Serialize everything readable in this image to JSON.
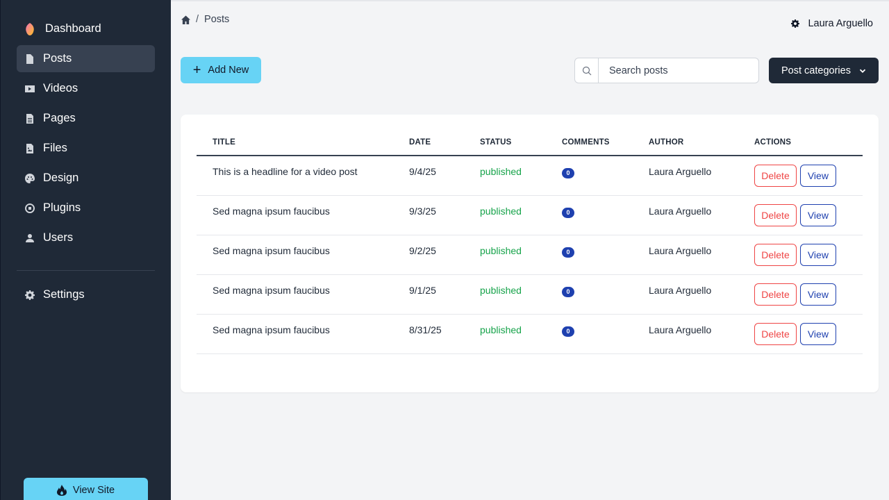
{
  "sidebar": {
    "brand": {
      "label": "Dashboard",
      "icon": "leaf-logo-icon",
      "colors": [
        "#f472b6",
        "#fbbf24"
      ]
    },
    "items": [
      {
        "label": "Posts",
        "icon": "file-icon",
        "active": true
      },
      {
        "label": "Videos",
        "icon": "video-icon",
        "active": false
      },
      {
        "label": "Pages",
        "icon": "document-icon",
        "active": false
      },
      {
        "label": "Files",
        "icon": "file-image-icon",
        "active": false
      },
      {
        "label": "Design",
        "icon": "palette-icon",
        "active": false
      },
      {
        "label": "Plugins",
        "icon": "plugin-icon",
        "active": false
      },
      {
        "label": "Users",
        "icon": "user-icon",
        "active": false
      }
    ],
    "settings": {
      "label": "Settings",
      "icon": "gear-icon"
    },
    "view_site": {
      "label": "View Site",
      "icon": "fire-icon"
    }
  },
  "breadcrumb": {
    "home_icon": "home-icon",
    "current": "Posts"
  },
  "user": {
    "name": "Laura Arguello",
    "icon": "gear-icon"
  },
  "toolbar": {
    "add_new_label": "Add New",
    "search_placeholder": "Search posts",
    "search_value": "",
    "categories_label": "Post categories"
  },
  "table": {
    "columns": [
      "TITLE",
      "DATE",
      "STATUS",
      "COMMENTS",
      "AUTHOR",
      "ACTIONS"
    ],
    "rows": [
      {
        "title": "This is a headline for a video post",
        "date": "9/4/25",
        "status": "published",
        "comments": "0",
        "author": "Laura Arguello"
      },
      {
        "title": "Sed magna ipsum faucibus",
        "date": "9/3/25",
        "status": "published",
        "comments": "0",
        "author": "Laura Arguello"
      },
      {
        "title": "Sed magna ipsum faucibus",
        "date": "9/2/25",
        "status": "published",
        "comments": "0",
        "author": "Laura Arguello"
      },
      {
        "title": "Sed magna ipsum faucibus",
        "date": "9/1/25",
        "status": "published",
        "comments": "0",
        "author": "Laura Arguello"
      },
      {
        "title": "Sed magna ipsum faucibus",
        "date": "8/31/25",
        "status": "published",
        "comments": "0",
        "author": "Laura Arguello"
      }
    ],
    "delete_label": "Delete",
    "view_label": "View"
  },
  "colors": {
    "sidebar_bg": "#1f2937",
    "accent": "#67d3f5",
    "published": "#16a34a",
    "danger": "#ef4444",
    "primary": "#1e40af"
  }
}
